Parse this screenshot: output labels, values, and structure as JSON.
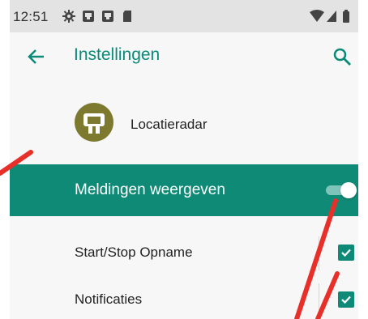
{
  "status_bar": {
    "time": "12:51",
    "left_icons": [
      "gear-icon",
      "image-icon",
      "image-icon",
      "sd-card-icon"
    ],
    "right_icons": [
      "wifi-icon",
      "signal-icon",
      "battery-icon"
    ]
  },
  "app_bar": {
    "title": "Instellingen",
    "back_icon": "arrow-back-icon",
    "search_icon": "search-icon"
  },
  "app": {
    "name": "Locatieradar",
    "icon_color": "#7d7a2f"
  },
  "master_switch": {
    "label": "Meldingen weergeven",
    "on": true
  },
  "preferences": [
    {
      "label": "Start/Stop Opname",
      "checked": true
    },
    {
      "label": "Notificaties",
      "checked": true
    }
  ],
  "colors": {
    "accent": "#0f8a77",
    "status_bar": "#e3e3e3",
    "annotation": "#e8302a"
  }
}
